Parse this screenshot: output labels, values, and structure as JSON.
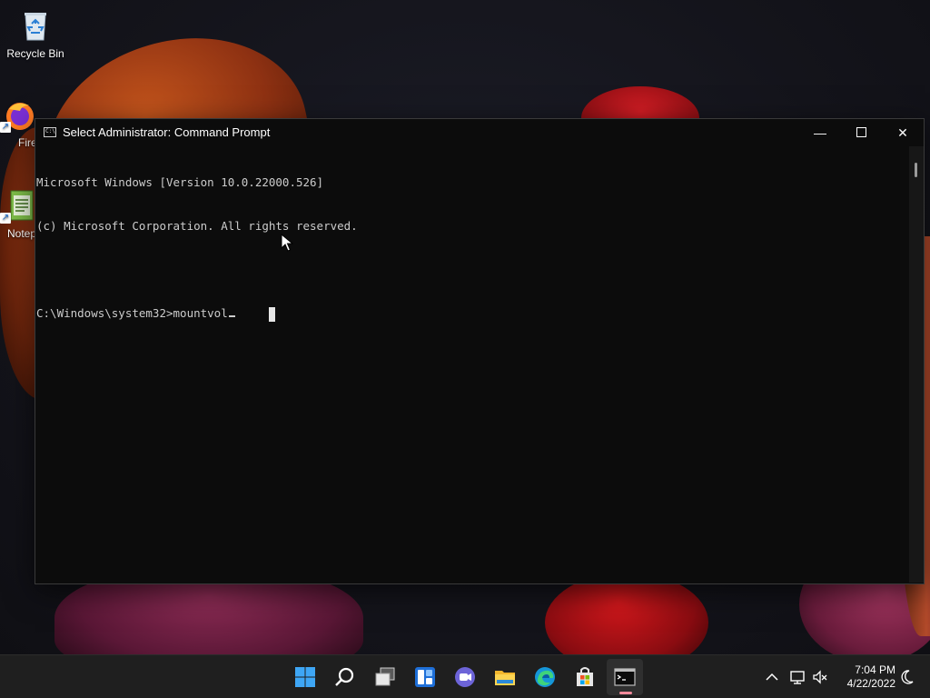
{
  "desktop": {
    "icons": [
      {
        "label": "Recycle Bin",
        "icon": "recycle-bin-icon"
      },
      {
        "label": "Fire",
        "icon": "firefox-icon"
      },
      {
        "label": "Notep",
        "icon": "notepad-icon"
      }
    ]
  },
  "window": {
    "title": "Select Administrator: Command Prompt",
    "icon_glyph": "C:\\",
    "minimize_glyph": "—",
    "close_glyph": "✕",
    "lines": [
      "Microsoft Windows [Version 10.0.22000.526]",
      "(c) Microsoft Corporation. All rights reserved.",
      "",
      "C:\\Windows\\system32>mountvol"
    ]
  },
  "taskbar": {
    "apps": [
      "start-icon",
      "search-icon",
      "task-view-icon",
      "widgets-icon",
      "chat-icon",
      "file-explorer-icon",
      "edge-icon",
      "store-icon",
      "terminal-icon"
    ],
    "active_app": "terminal-icon",
    "clock": {
      "time": "7:04 PM",
      "date": "4/22/2022"
    }
  },
  "colors": {
    "console_bg": "#0c0c0c",
    "console_text": "#cccccc",
    "taskbar_bg": "#1f1f1f",
    "active_indicator": "#f28a9b"
  }
}
